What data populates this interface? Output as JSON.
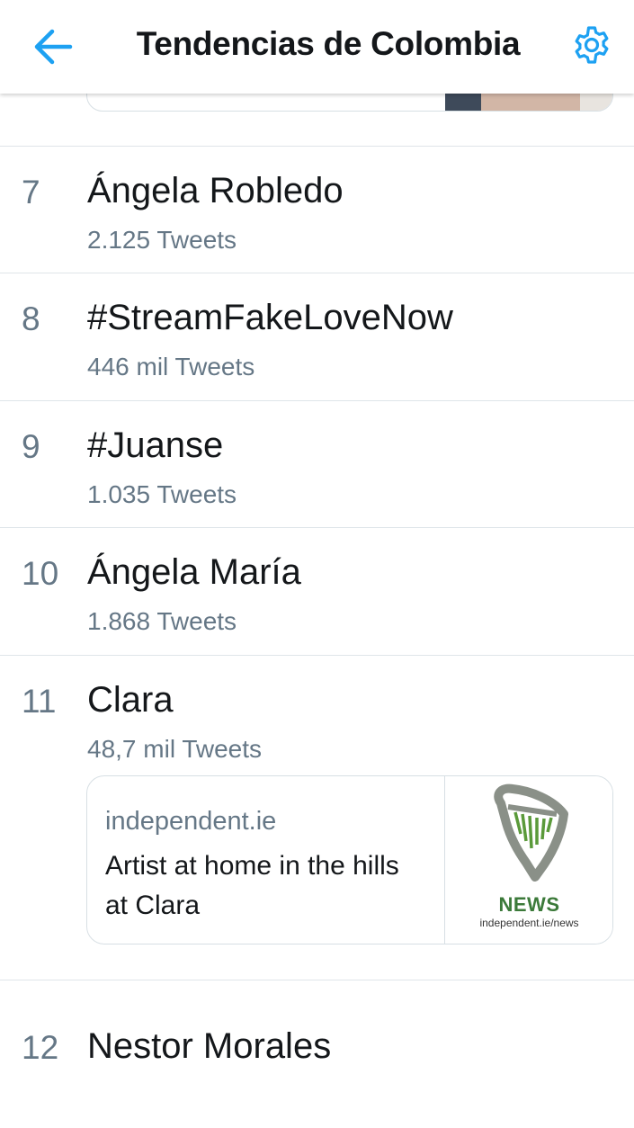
{
  "header": {
    "title": "Tendencias de Colombia",
    "back_icon": "arrow-left-icon",
    "settings_icon": "gear-icon",
    "accent": "#1da1f2"
  },
  "trends": [
    {
      "rank": "7",
      "name": "Ángela Robledo",
      "count": "2.125 Tweets"
    },
    {
      "rank": "8",
      "name": "#StreamFakeLoveNow",
      "count": "446 mil Tweets"
    },
    {
      "rank": "9",
      "name": "#Juanse",
      "count": "1.035 Tweets"
    },
    {
      "rank": "10",
      "name": "Ángela María",
      "count": "1.868 Tweets"
    },
    {
      "rank": "11",
      "name": "Clara",
      "count": "48,7 mil Tweets"
    },
    {
      "rank": "12",
      "name": "Nestor Morales",
      "count": ""
    }
  ],
  "news_card": {
    "domain": "independent.ie",
    "headline": "Artist at home in the hills at Clara",
    "thumb_label": "NEWS",
    "thumb_url": "independent.ie/news",
    "thumb_icon": "harp-logo-icon"
  },
  "colors": {
    "text_primary": "#14171a",
    "text_secondary": "#657786",
    "divider": "#dfe5e9"
  }
}
